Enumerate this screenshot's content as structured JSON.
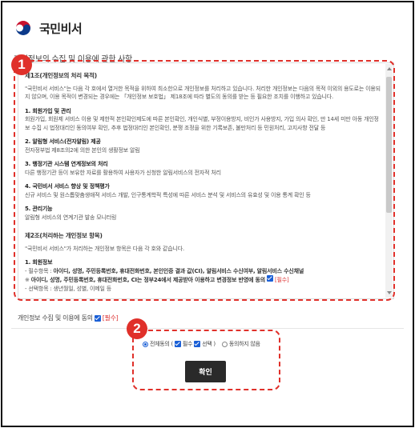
{
  "brand": {
    "name": "국민비서"
  },
  "section": {
    "title": "개인정보의 수집 및 이용에 관한 사항"
  },
  "terms": {
    "article1_title": "제1조(개인정보의 처리 목적)",
    "article1_intro": "\"국민비서 서비스\"는 다음 각 호에서 열거한 목적을 위하여 최소한으로 개인정보를 처리하고 있습니다. 처리한 개인정보는 다음의 목적 이외의 용도로는 이용되지 않으며, 이용 목적이 변경되는 경우에는 「개인정보 보호법」 제18조에 따라 별도의 동의를 받는 등 필요한 조치를 이행하고 있습니다.",
    "items": [
      {
        "title": "1. 회원가입 및 관리",
        "text": "회원가입, 회원제 서비스 이용 및 제한적 본인확인제도에 따른 본인확인, 개인식별, 부정이용방지, 비인가 사용방지, 가입 의사 확인, 만 14세 미만 아동 개인정보 수집 시 법정대리인 동의여부 확인, 추후 법정대리인 본인확인, 분쟁 조정을 위한 기록보존, 불만처리 등 민원처리, 고지사항 전달 등"
      },
      {
        "title": "2. 알림형 서비스(전자알림) 제공",
        "text": "전자정부법 제8조의2에 의한 본인의 생활정보 알림"
      },
      {
        "title": "3. 행정기관 시스템 연계정보의 처리",
        "text": "다른 행정기관 등이 보유한 자료를 활용하여 사용자가 신청한 알림서비스의 전자적 처리"
      },
      {
        "title": "4. 국민비서 서비스 향상 및 정책평가",
        "text": "신규 서비스 및 원스톱맞춤생애적 서비스 개발, 인구통계학적 특성에 따른 서비스 분석 및 서비스의 유효성 및 이용 통계 확인 등"
      },
      {
        "title": "5. 관리기능",
        "text": "알림형 서비스의 연계기관 발송 모니터링"
      }
    ],
    "article2_title": "제2조(처리하는 개인정보 항목)",
    "article2_intro": "\"국민비서 서비스\"가 처리하는 개인정보 항목은 다음 각 호와 같습니다.",
    "member_title": "1. 회원정보",
    "required_prefix": "- 필수항목 : ",
    "required_items": "아이디, 성명, 주민등록번호, 휴대전화번호, 본인인증 결과 값(CI), 알림서비스 수신여부, 알림서비스 수신채널",
    "note_prefix": "※ ",
    "note_text": "아이디, 성명, 주민등록번호, 휴대전화번호, CI는 정부24에서 제공받아 이용하고 변경정보 반영에 동의",
    "required_tag": "[필수]",
    "cut_line": "- 선택항목 : 생년월일, 성별, 이메일 등"
  },
  "consent": {
    "label": "개인정보 수집 및 이용에 동의",
    "required_tag": "[필수]"
  },
  "options": {
    "all_agree": "전체동의 (",
    "required": "필수",
    "optional": "선택 )",
    "disagree": "동의하지 않음"
  },
  "confirm_label": "확인",
  "badges": {
    "one": "1",
    "two": "2"
  },
  "colors": {
    "highlight": "#e0302a",
    "checkbox": "#1a5fd6",
    "button": "#2a2a2a"
  }
}
